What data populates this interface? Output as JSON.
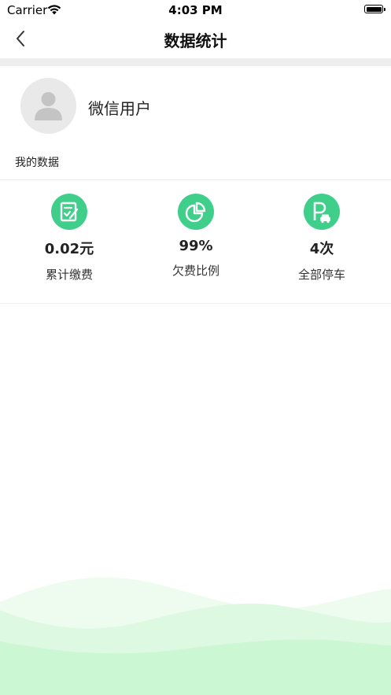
{
  "status_bar": {
    "carrier": "Carrier",
    "time": "4:03 PM"
  },
  "nav": {
    "title": "数据统计",
    "back_icon": "chevron-left-icon"
  },
  "profile": {
    "username": "微信用户",
    "avatar_icon": "user-silhouette-icon"
  },
  "section": {
    "label": "我的数据"
  },
  "stats": [
    {
      "value": "0.02元",
      "label": "累计缴费",
      "icon": "payment-edit-icon"
    },
    {
      "value": "99%",
      "label": "欠费比例",
      "icon": "pie-chart-icon"
    },
    {
      "value": "4次",
      "label": "全部停车",
      "icon": "parking-car-icon"
    }
  ],
  "colors": {
    "accent": "#3fcf8a",
    "wave_light": "#e6fbe9",
    "wave_mid": "#c9f6cf"
  }
}
